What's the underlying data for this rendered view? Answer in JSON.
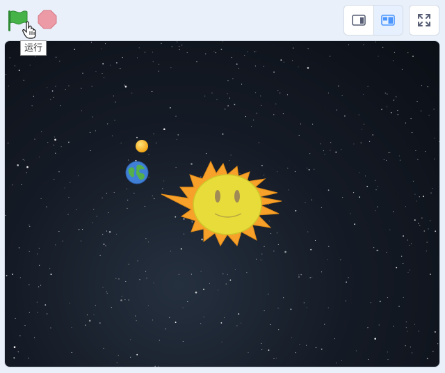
{
  "controls": {
    "run_tooltip": "运行",
    "green_flag_icon": "green-flag-icon",
    "stop_icon": "stop-sign-icon"
  },
  "layout_modes": {
    "small_stage_icon": "small-stage-icon",
    "normal_stage_icon": "normal-stage-icon",
    "active": "normal-stage"
  },
  "fullscreen_icon": "fullscreen-icon",
  "stage": {
    "backdrop": "starry-space",
    "sprites": [
      "moon",
      "earth",
      "sun"
    ]
  },
  "colors": {
    "flag_green": "#45b347",
    "stop_red": "#ec9aa5",
    "accent_blue": "#4c97ff",
    "sun_orange": "#f7a12a",
    "sun_face": "#e8dc3a"
  }
}
